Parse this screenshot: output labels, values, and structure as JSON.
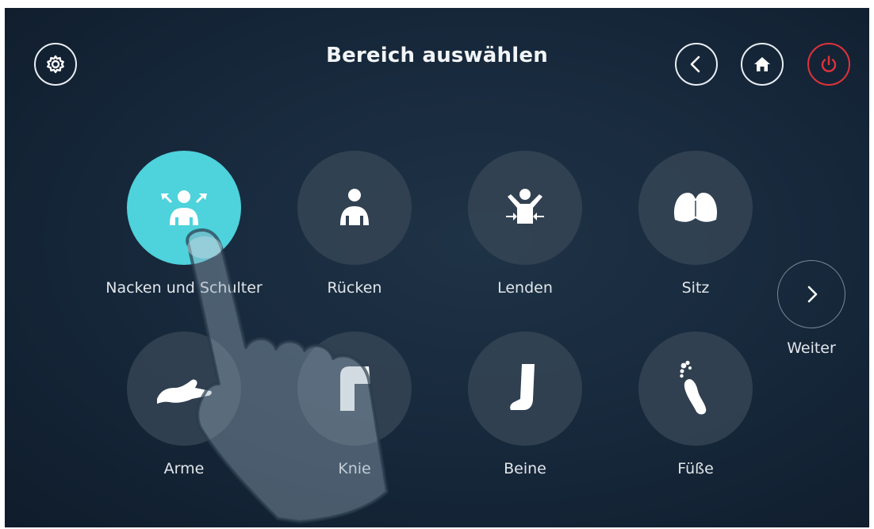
{
  "header": {
    "title": "Bereich auswählen",
    "settings_icon": "gear-icon",
    "back_icon": "chevron-left-icon",
    "home_icon": "home-icon",
    "power_icon": "power-icon",
    "power_color": "#e0323a"
  },
  "areas": [
    {
      "label": "Nacken und Schulter",
      "icon": "neck-shoulder-icon",
      "selected": true
    },
    {
      "label": "Rücken",
      "icon": "back-icon",
      "selected": false
    },
    {
      "label": "Lenden",
      "icon": "lumbar-icon",
      "selected": false
    },
    {
      "label": "Sitz",
      "icon": "seat-icon",
      "selected": false
    },
    {
      "label": "Arme",
      "icon": "arm-icon",
      "selected": false
    },
    {
      "label": "Knie",
      "icon": "knee-icon",
      "selected": false
    },
    {
      "label": "Beine",
      "icon": "leg-icon",
      "selected": false
    },
    {
      "label": "Füße",
      "icon": "foot-icon",
      "selected": false
    }
  ],
  "next": {
    "label": "Weiter",
    "icon": "chevron-right-icon"
  },
  "colors": {
    "accent": "#4ed2dc",
    "background": "#16273a",
    "circle": "#364656"
  }
}
